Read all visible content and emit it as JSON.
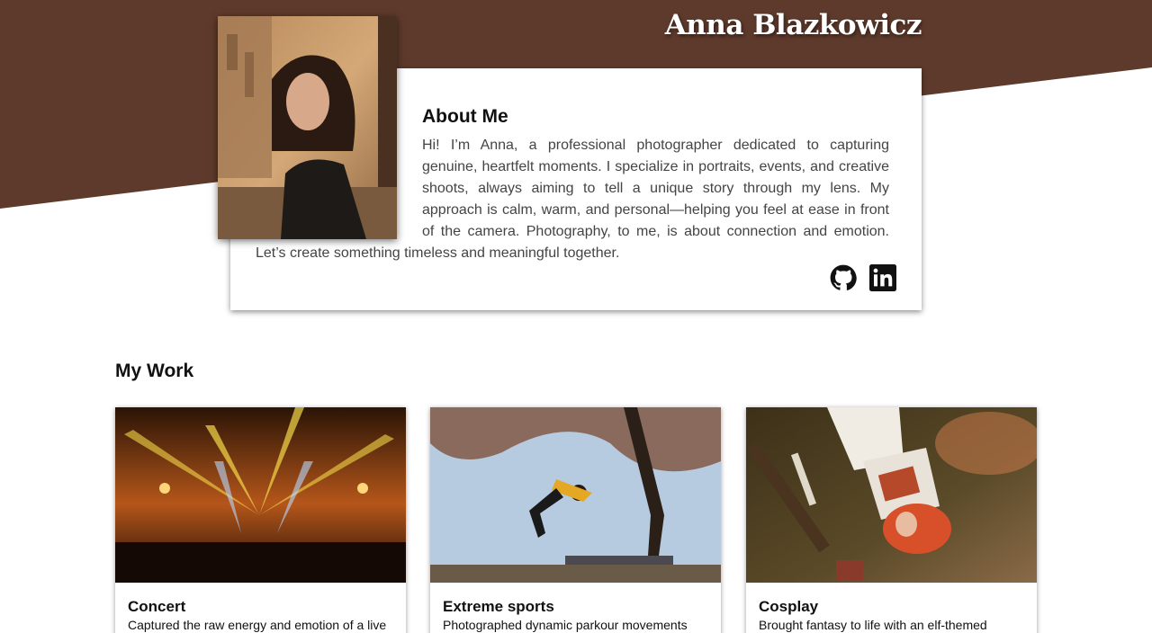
{
  "header": {
    "name": "Anna Blazkowicz",
    "band_color": "#5e3a2c"
  },
  "about": {
    "title": "About Me",
    "text": "Hi! I’m Anna, a professional photographer dedicated to capturing genuine, heartfelt moments. I specialize in portraits, events, and creative shoots, always aiming to tell a unique story through my lens. My approach is calm, warm, and personal—helping you feel at ease in front of the camera. Photography, to me, is about connection and emotion. Let’s create something timeless and meaningful together.",
    "social": [
      {
        "name": "github-icon"
      },
      {
        "name": "linkedin-icon"
      }
    ]
  },
  "work": {
    "title": "My Work",
    "items": [
      {
        "title": "Concert",
        "description": "Captured the raw energy and emotion of a live"
      },
      {
        "title": "Extreme sports",
        "description": "Photographed dynamic parkour movements"
      },
      {
        "title": "Cosplay",
        "description": "Brought fantasy to life with an elf-themed"
      }
    ]
  }
}
